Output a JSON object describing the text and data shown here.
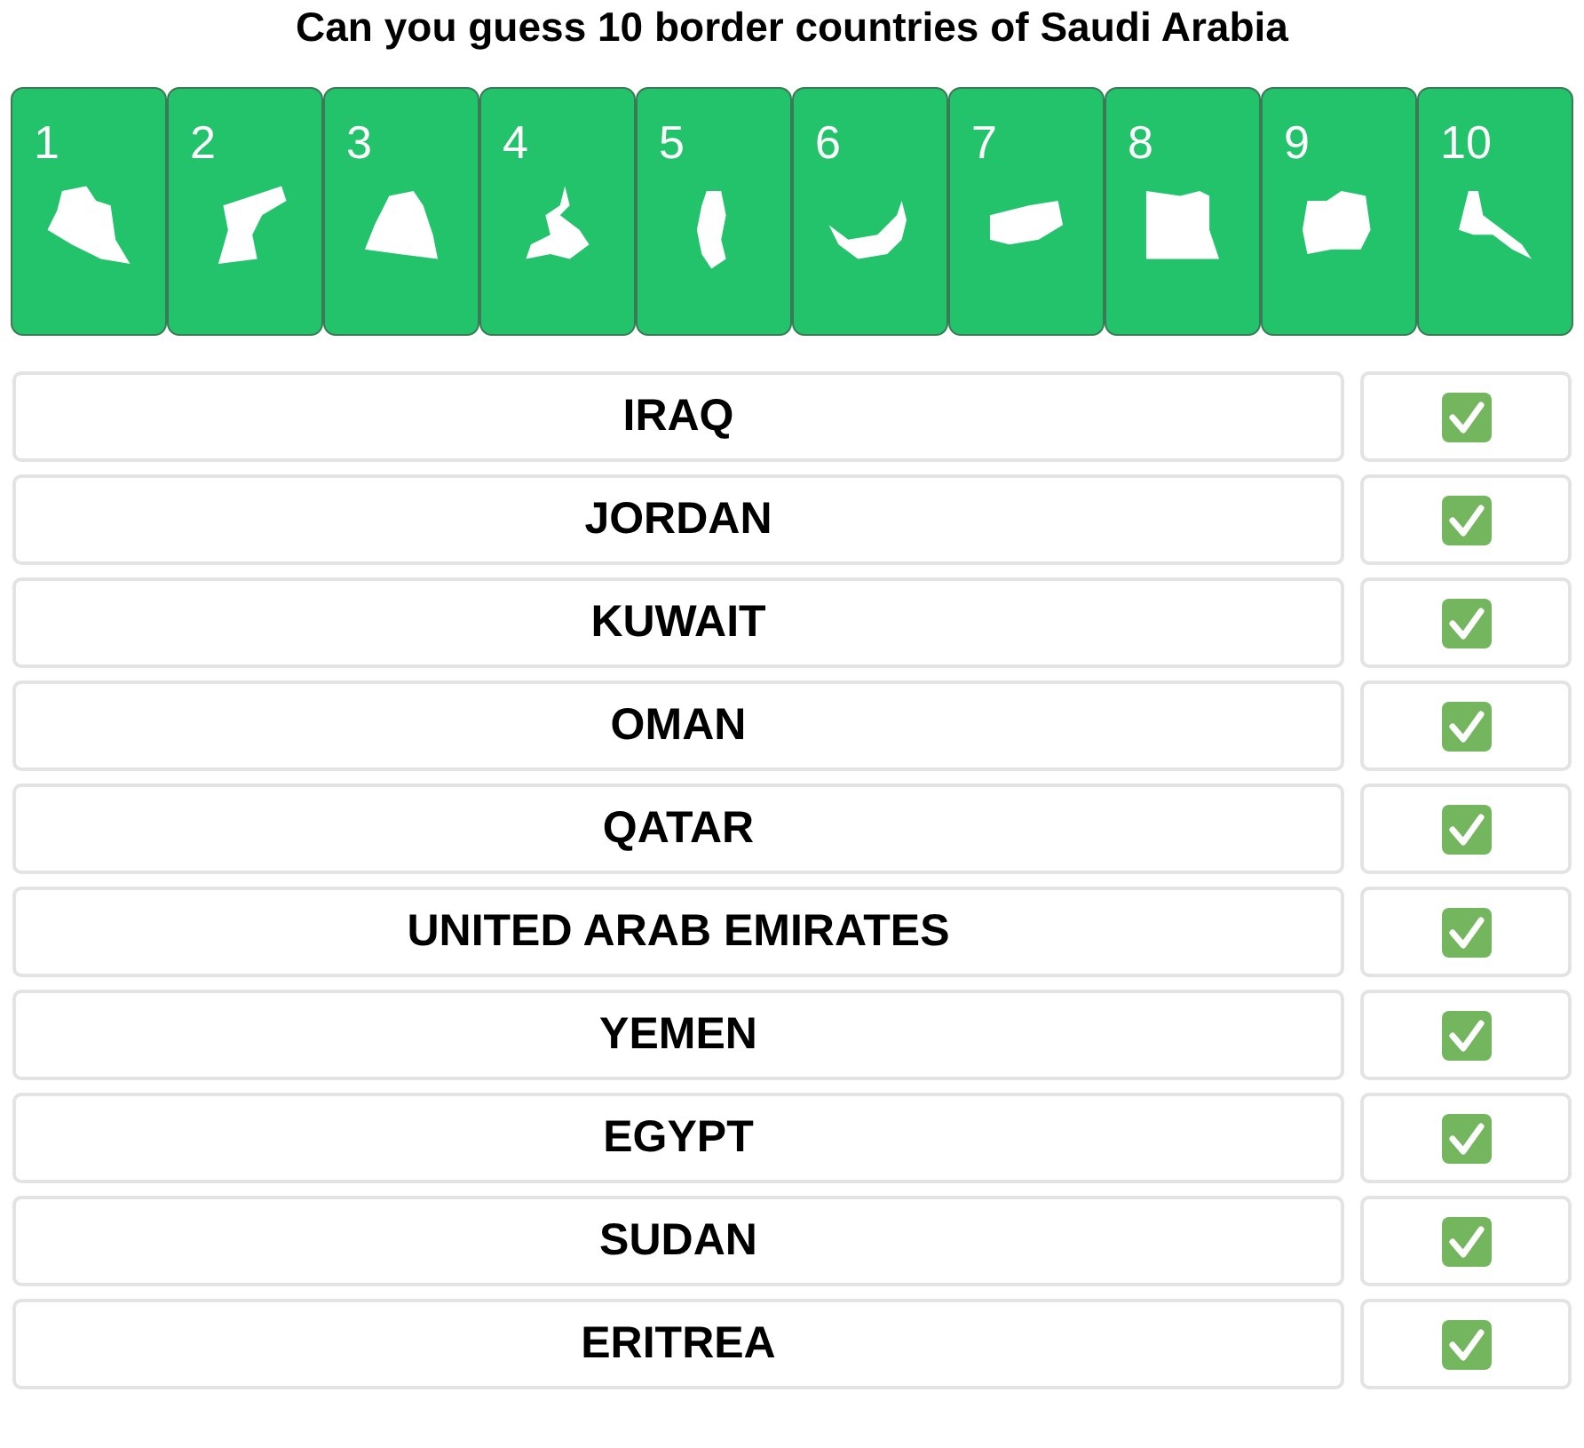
{
  "title": "Can you guess 10 border countries of Saudi Arabia",
  "tiles": [
    {
      "number": "1"
    },
    {
      "number": "2"
    },
    {
      "number": "3"
    },
    {
      "number": "4"
    },
    {
      "number": "5"
    },
    {
      "number": "6"
    },
    {
      "number": "7"
    },
    {
      "number": "8"
    },
    {
      "number": "9"
    },
    {
      "number": "10"
    }
  ],
  "rows": [
    {
      "answer": "IRAQ",
      "correct": true
    },
    {
      "answer": "JORDAN",
      "correct": true
    },
    {
      "answer": "KUWAIT",
      "correct": true
    },
    {
      "answer": "OMAN",
      "correct": true
    },
    {
      "answer": "QATAR",
      "correct": true
    },
    {
      "answer": "UNITED ARAB EMIRATES",
      "correct": true
    },
    {
      "answer": "YEMEN",
      "correct": true
    },
    {
      "answer": "EGYPT",
      "correct": true
    },
    {
      "answer": "SUDAN",
      "correct": true
    },
    {
      "answer": "ERITREA",
      "correct": true
    }
  ]
}
